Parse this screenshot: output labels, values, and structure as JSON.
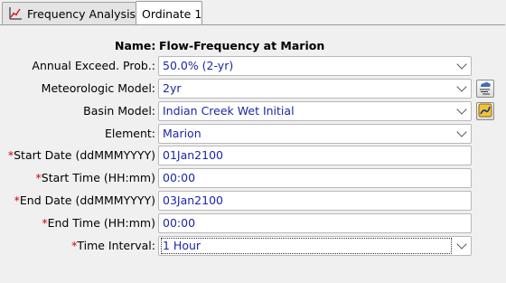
{
  "tabs": [
    {
      "label": "Frequency Analysis",
      "icon": "frequency-chart-icon"
    },
    {
      "label": "Ordinate 1"
    }
  ],
  "form": {
    "name_label": "Name:",
    "name_value": "Flow-Frequency at Marion",
    "aep_label": "Annual Exceed. Prob.:",
    "aep_value": "50.0% (2-yr)",
    "met_label": "Meteorologic Model:",
    "met_value": "2yr",
    "met_button_icon": "meteorologic-model-icon",
    "basin_label": "Basin Model:",
    "basin_value": "Indian Creek Wet Initial",
    "basin_button_icon": "basin-model-icon",
    "element_label": "Element:",
    "element_value": "Marion",
    "required_mark": "*",
    "start_date_label": "Start Date (ddMMMYYYY)",
    "start_date_value": "01Jan2100",
    "start_time_label": "Start Time (HH:mm)",
    "start_time_value": "00:00",
    "end_date_label": "End Date (ddMMMYYYY)",
    "end_date_value": "03Jan2100",
    "end_time_label": "End Time (HH:mm)",
    "end_time_value": "00:00",
    "interval_label": "Time Interval:",
    "interval_value": "1 Hour"
  },
  "colors": {
    "value_text": "#1a27a8",
    "required_mark": "#d40000"
  }
}
